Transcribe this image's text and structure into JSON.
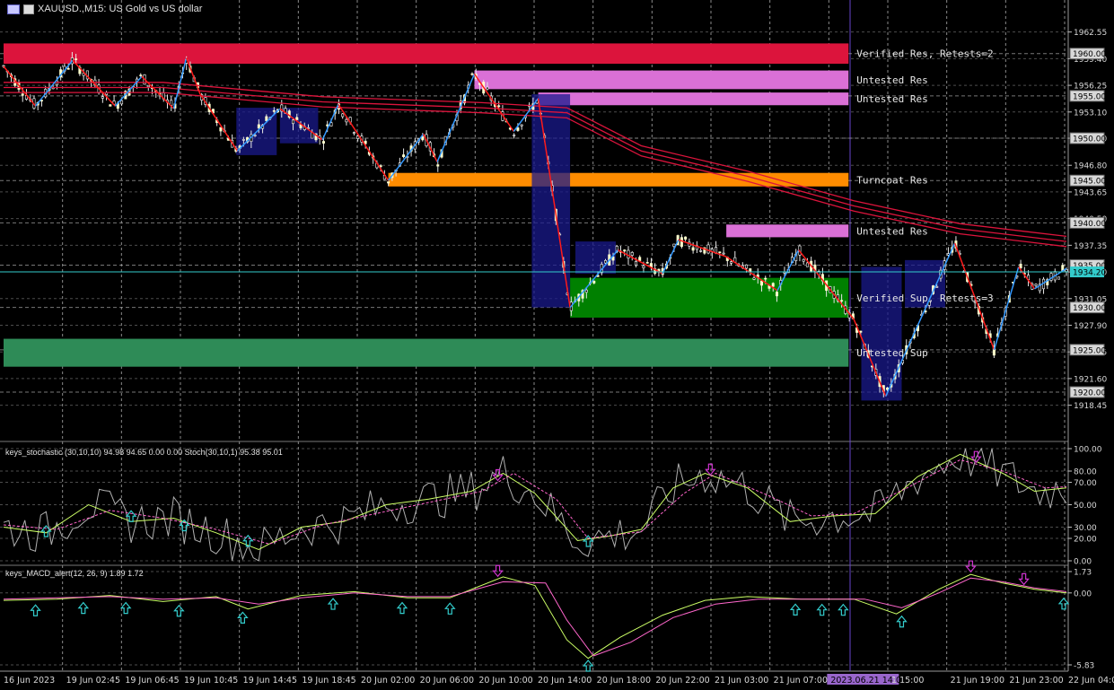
{
  "header": {
    "title": "XAUUSD.,M15:  US Gold vs US dollar"
  },
  "colors": {
    "background": "#000000",
    "grid": "#8a8a8a",
    "axis": "#c0c0c0",
    "ema": "#dc143c",
    "zigzag_up": "#3399ff",
    "zigzag_down": "#ff1a1a",
    "stoch_main": "#b0b0b0",
    "stoch_k": "#ccff66",
    "stoch_d": "#ff66cc",
    "macd_main": "#ccff66",
    "macd_signal": "#ff66cc",
    "arrow_up": "#33cccc",
    "arrow_down": "#cc33cc",
    "current_price_line": "#33cccc",
    "session_line": "#6644cc"
  },
  "chart_data": [
    {
      "type": "line",
      "name": "price",
      "ylim": [
        1916.5,
        1964.0
      ],
      "y_ticks": [
        "1962.55",
        "1959.40",
        "1956.25",
        "1953.10",
        "1950.00",
        "1946.80",
        "1943.65",
        "1940.50",
        "1937.35",
        "1934.20",
        "1931.05",
        "1927.90",
        "1924.75",
        "1921.60",
        "1918.45"
      ],
      "y_tick_values": [
        1962.55,
        1959.4,
        1956.25,
        1953.1,
        1950.0,
        1946.8,
        1943.65,
        1940.5,
        1937.35,
        1934.2,
        1931.05,
        1927.9,
        1924.75,
        1921.6,
        1918.45
      ],
      "level_labels": [
        "1960.00",
        "1955.00",
        "1950.00",
        "1945.00",
        "1940.00",
        "1935.00",
        "1930.00",
        "1925.00",
        "1920.00"
      ],
      "level_values": [
        1960,
        1955,
        1950,
        1945,
        1940,
        1935,
        1930,
        1925,
        1920
      ],
      "current_price": "1934.20",
      "current_price_value": 1934.2,
      "zones": [
        {
          "label": "Verified Res, Retests=2",
          "low": 1958.8,
          "high": 1961.2,
          "color": "#dc143c",
          "x_start": 0.0,
          "x_end": 0.795
        },
        {
          "label": "Untested Res",
          "low": 1955.8,
          "high": 1958.0,
          "color": "#da70d6",
          "x_start": 0.443,
          "x_end": 0.795
        },
        {
          "label": "Untested Res",
          "low": 1953.9,
          "high": 1955.4,
          "color": "#da70d6",
          "x_start": 0.503,
          "x_end": 0.795
        },
        {
          "label": "Turncoat Res",
          "low": 1944.3,
          "high": 1945.9,
          "color": "#ff8c00",
          "x_start": 0.362,
          "x_end": 0.795
        },
        {
          "label": "Untested Res",
          "low": 1938.3,
          "high": 1939.8,
          "color": "#da70d6",
          "x_start": 0.68,
          "x_end": 0.795
        },
        {
          "label": "Verified Sup, Retests=3",
          "low": 1928.8,
          "high": 1933.5,
          "color": "#008000",
          "x_start": 0.533,
          "x_end": 0.795
        },
        {
          "label": "Untested Sup",
          "low": 1923.0,
          "high": 1926.3,
          "color": "#2e8b57",
          "x_start": 0.0,
          "x_end": 0.795
        }
      ],
      "zigzag_points": [
        [
          0.0,
          1958.5
        ],
        [
          0.03,
          1953.8
        ],
        [
          0.065,
          1959.2
        ],
        [
          0.105,
          1953.8
        ],
        [
          0.13,
          1957.3
        ],
        [
          0.16,
          1953.5
        ],
        [
          0.172,
          1959.5
        ],
        [
          0.185,
          1955.2
        ],
        [
          0.22,
          1948.5
        ],
        [
          0.26,
          1953.5
        ],
        [
          0.3,
          1949.8
        ],
        [
          0.315,
          1954.0
        ],
        [
          0.362,
          1945.0
        ],
        [
          0.395,
          1950.5
        ],
        [
          0.408,
          1947.2
        ],
        [
          0.443,
          1957.6
        ],
        [
          0.48,
          1950.8
        ],
        [
          0.503,
          1954.7
        ],
        [
          0.533,
          1930.0
        ],
        [
          0.578,
          1936.8
        ],
        [
          0.62,
          1934.0
        ],
        [
          0.635,
          1938.0
        ],
        [
          0.68,
          1936.0
        ],
        [
          0.728,
          1932.0
        ],
        [
          0.748,
          1936.8
        ],
        [
          0.8,
          1928.6
        ],
        [
          0.83,
          1919.5
        ],
        [
          0.895,
          1937.6
        ],
        [
          0.932,
          1925.0
        ],
        [
          0.955,
          1934.8
        ],
        [
          0.97,
          1932.2
        ],
        [
          1.0,
          1934.6
        ]
      ],
      "ema_series": [
        [
          0.0,
          1956.0
        ],
        [
          0.15,
          1956.0
        ],
        [
          0.3,
          1954.3
        ],
        [
          0.45,
          1953.6
        ],
        [
          0.53,
          1953.0
        ],
        [
          0.6,
          1948.5
        ],
        [
          0.7,
          1945.5
        ],
        [
          0.8,
          1942.0
        ],
        [
          0.9,
          1939.3
        ],
        [
          1.0,
          1937.8
        ]
      ]
    },
    {
      "type": "line",
      "name": "keys_stochastic",
      "label": "keys_stochastic (30,10,10) 94.98 94.65 0.00 0.00 Stoch(30,10,1) 95.38 95.01",
      "ylim": [
        0,
        100
      ],
      "y_ticks": [
        "100.00",
        "80.00",
        "70.00",
        "50.00",
        "30.00",
        "20.00",
        "0.00"
      ],
      "y_tick_values": [
        100,
        80,
        70,
        50,
        30,
        20,
        0
      ],
      "k_series": [
        [
          0.0,
          30
        ],
        [
          0.04,
          25
        ],
        [
          0.08,
          50
        ],
        [
          0.12,
          35
        ],
        [
          0.16,
          38
        ],
        [
          0.2,
          25
        ],
        [
          0.24,
          10
        ],
        [
          0.28,
          30
        ],
        [
          0.32,
          35
        ],
        [
          0.36,
          50
        ],
        [
          0.4,
          55
        ],
        [
          0.44,
          62
        ],
        [
          0.47,
          78
        ],
        [
          0.5,
          60
        ],
        [
          0.54,
          18
        ],
        [
          0.57,
          22
        ],
        [
          0.6,
          28
        ],
        [
          0.63,
          65
        ],
        [
          0.66,
          78
        ],
        [
          0.7,
          65
        ],
        [
          0.74,
          35
        ],
        [
          0.78,
          40
        ],
        [
          0.82,
          42
        ],
        [
          0.86,
          75
        ],
        [
          0.9,
          95
        ],
        [
          0.94,
          78
        ],
        [
          0.97,
          62
        ],
        [
          1.0,
          65
        ]
      ],
      "d_series": [
        [
          0.0,
          32
        ],
        [
          0.05,
          28
        ],
        [
          0.1,
          45
        ],
        [
          0.15,
          38
        ],
        [
          0.2,
          28
        ],
        [
          0.25,
          15
        ],
        [
          0.3,
          32
        ],
        [
          0.35,
          42
        ],
        [
          0.4,
          52
        ],
        [
          0.45,
          62
        ],
        [
          0.48,
          78
        ],
        [
          0.52,
          55
        ],
        [
          0.55,
          20
        ],
        [
          0.6,
          26
        ],
        [
          0.64,
          60
        ],
        [
          0.67,
          78
        ],
        [
          0.72,
          58
        ],
        [
          0.76,
          40
        ],
        [
          0.8,
          42
        ],
        [
          0.85,
          65
        ],
        [
          0.9,
          90
        ],
        [
          0.94,
          80
        ],
        [
          0.98,
          65
        ],
        [
          1.0,
          66
        ]
      ],
      "arrows_up": [
        0.04,
        0.12,
        0.17,
        0.23,
        0.55
      ],
      "arrows_down": [
        0.465,
        0.665,
        0.915
      ]
    },
    {
      "type": "line",
      "name": "keys_MACD_alert",
      "label": "keys_MACD_alert(12, 26, 9) 1.89 1.72",
      "ylim": [
        -5.83,
        1.73
      ],
      "y_ticks": [
        "1.73",
        "0.00",
        "-5.83"
      ],
      "y_tick_values": [
        1.73,
        0.0,
        -5.83
      ],
      "main_series": [
        [
          0.0,
          -0.6
        ],
        [
          0.05,
          -0.5
        ],
        [
          0.1,
          -0.2
        ],
        [
          0.15,
          -0.7
        ],
        [
          0.2,
          -0.3
        ],
        [
          0.23,
          -1.3
        ],
        [
          0.28,
          -0.2
        ],
        [
          0.33,
          0.1
        ],
        [
          0.38,
          -0.4
        ],
        [
          0.42,
          -0.4
        ],
        [
          0.47,
          1.3
        ],
        [
          0.5,
          0.6
        ],
        [
          0.53,
          -3.8
        ],
        [
          0.55,
          -5.3
        ],
        [
          0.58,
          -3.6
        ],
        [
          0.62,
          -1.8
        ],
        [
          0.66,
          -0.6
        ],
        [
          0.7,
          -0.3
        ],
        [
          0.75,
          -0.5
        ],
        [
          0.8,
          -0.5
        ],
        [
          0.84,
          -1.7
        ],
        [
          0.88,
          0.3
        ],
        [
          0.91,
          1.5
        ],
        [
          0.94,
          0.8
        ],
        [
          0.97,
          0.3
        ],
        [
          1.0,
          0.0
        ]
      ],
      "signal_series": [
        [
          0.0,
          -0.5
        ],
        [
          0.05,
          -0.4
        ],
        [
          0.1,
          -0.3
        ],
        [
          0.15,
          -0.5
        ],
        [
          0.2,
          -0.4
        ],
        [
          0.24,
          -0.9
        ],
        [
          0.28,
          -0.4
        ],
        [
          0.33,
          0.0
        ],
        [
          0.38,
          -0.3
        ],
        [
          0.42,
          -0.3
        ],
        [
          0.47,
          0.9
        ],
        [
          0.51,
          0.8
        ],
        [
          0.53,
          -2.2
        ],
        [
          0.555,
          -5.1
        ],
        [
          0.59,
          -4.0
        ],
        [
          0.63,
          -2.0
        ],
        [
          0.67,
          -0.9
        ],
        [
          0.71,
          -0.5
        ],
        [
          0.76,
          -0.5
        ],
        [
          0.81,
          -0.5
        ],
        [
          0.845,
          -1.2
        ],
        [
          0.88,
          0.0
        ],
        [
          0.91,
          1.2
        ],
        [
          0.94,
          0.9
        ],
        [
          0.97,
          0.4
        ],
        [
          1.0,
          0.1
        ]
      ],
      "arrows_up": [
        0.03,
        0.075,
        0.115,
        0.165,
        0.225,
        0.31,
        0.375,
        0.42,
        0.55,
        0.745,
        0.77,
        0.79,
        0.845,
        1.0
      ],
      "arrows_down": [
        0.465,
        0.91,
        0.96
      ]
    }
  ],
  "time_axis": {
    "labels": [
      "16 Jun 2023",
      "19 Jun 02:45",
      "19 Jun 06:45",
      "19 Jun 10:45",
      "19 Jun 14:45",
      "19 Jun 18:45",
      "20 Jun 02:00",
      "20 Jun 06:00",
      "20 Jun 10:00",
      "20 Jun 14:00",
      "20 Jun 18:00",
      "20 Jun 22:00",
      "21 Jun 03:00",
      "21 Jun 07:00",
      "2023.06.21 14:00",
      "1 15:00",
      "21 Jun 19:00",
      "21 Jun 23:00",
      "22 Jun 04:00"
    ],
    "highlight_index": 14
  }
}
